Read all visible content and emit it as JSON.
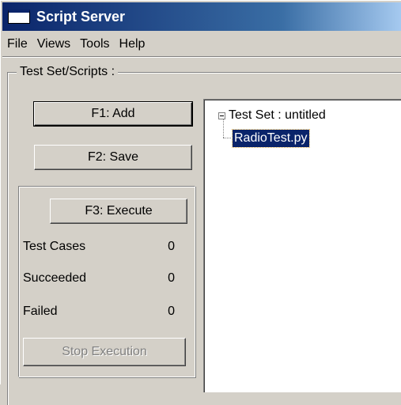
{
  "window": {
    "title": "Script Server"
  },
  "menu": {
    "items": [
      "File",
      "Views",
      "Tools",
      "Help"
    ]
  },
  "group": {
    "legend": "Test Set/Scripts :"
  },
  "buttons": {
    "add": "F1:  Add",
    "save": "F2:  Save",
    "execute": "F3:  Execute",
    "stop": "Stop Execution"
  },
  "stats": [
    {
      "label": "Test Cases",
      "value": "0"
    },
    {
      "label": "Succeeded",
      "value": "0"
    },
    {
      "label": "Failed",
      "value": "0"
    }
  ],
  "tree": {
    "root_label": "Test Set : untitled",
    "children": [
      "RadioTest.py"
    ]
  },
  "colors": {
    "title_start": "#0a246a",
    "title_end": "#a6caf0",
    "selection": "#0a246a",
    "face": "#d4d0c8"
  }
}
